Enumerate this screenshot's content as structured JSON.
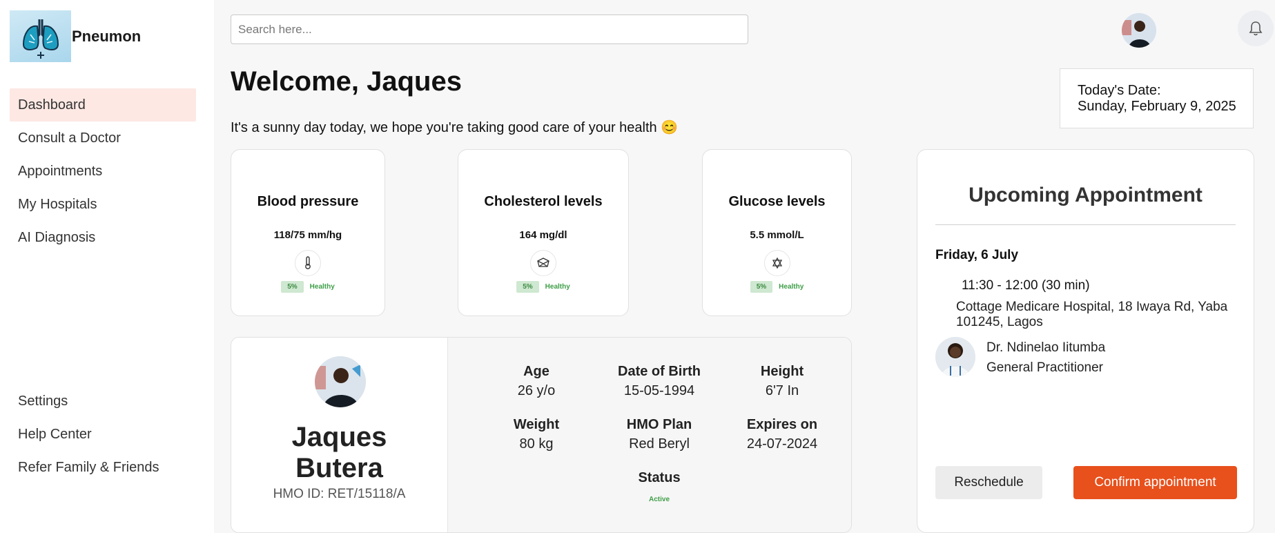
{
  "brand": {
    "name": "Pneumon",
    "logo_icon": "lungs-icon"
  },
  "sidebar": {
    "items": [
      {
        "label": "Dashboard",
        "active": true
      },
      {
        "label": "Consult a Doctor"
      },
      {
        "label": "Appointments"
      },
      {
        "label": "My Hospitals"
      },
      {
        "label": "AI Diagnosis"
      }
    ],
    "bottom_items": [
      {
        "label": "Settings"
      },
      {
        "label": "Help Center"
      },
      {
        "label": "Refer Family & Friends"
      }
    ]
  },
  "header": {
    "search_placeholder": "Search here...",
    "search_value": "",
    "notification_icon": "bell-icon"
  },
  "welcome": {
    "title": "Welcome, Jaques",
    "subtitle": "It's a sunny day today, we hope you're taking good care of your health 😊"
  },
  "date": {
    "label": "Today's Date:",
    "value": "Sunday, February 9, 2025"
  },
  "metrics": [
    {
      "title": "Blood pressure",
      "value": "118/75 mm/hg",
      "icon": "thermometer-icon",
      "change": "5%",
      "status": "Healthy"
    },
    {
      "title": "Cholesterol levels",
      "value": "164 mg/dl",
      "icon": "cube-icon",
      "change": "5%",
      "status": "Healthy"
    },
    {
      "title": "Glucose levels",
      "value": "5.5 mmol/L",
      "icon": "hexagram-icon",
      "change": "5%",
      "status": "Healthy"
    }
  ],
  "profile": {
    "first_name": "Jaques",
    "last_name": "Butera",
    "hmo_id": "HMO ID: RET/15118/A",
    "fields": {
      "age": {
        "label": "Age",
        "value": "26 y/o"
      },
      "dob": {
        "label": "Date of Birth",
        "value": "15-05-1994"
      },
      "height": {
        "label": "Height",
        "value": "6'7 In"
      },
      "weight": {
        "label": "Weight",
        "value": "80 kg"
      },
      "hmo_plan": {
        "label": "HMO Plan",
        "value": "Red Beryl"
      },
      "expires": {
        "label": "Expires on",
        "value": "24-07-2024"
      },
      "status": {
        "label": "Status",
        "value": "Active"
      }
    }
  },
  "appointment": {
    "title": "Upcoming Appointment",
    "date": "Friday, 6 July",
    "time": "11:30 - 12:00 (30 min)",
    "location": "Cottage Medicare Hospital, 18 Iwaya Rd, Yaba 101245, Lagos",
    "doctor_name": "Dr. Ndinelao Iitumba",
    "doctor_role": "General Practitioner",
    "reschedule_label": "Reschedule",
    "confirm_label": "Confirm appointment"
  },
  "colors": {
    "accent": "#e8501c",
    "active_nav": "#fde8e3",
    "healthy": "#3e9e47"
  }
}
